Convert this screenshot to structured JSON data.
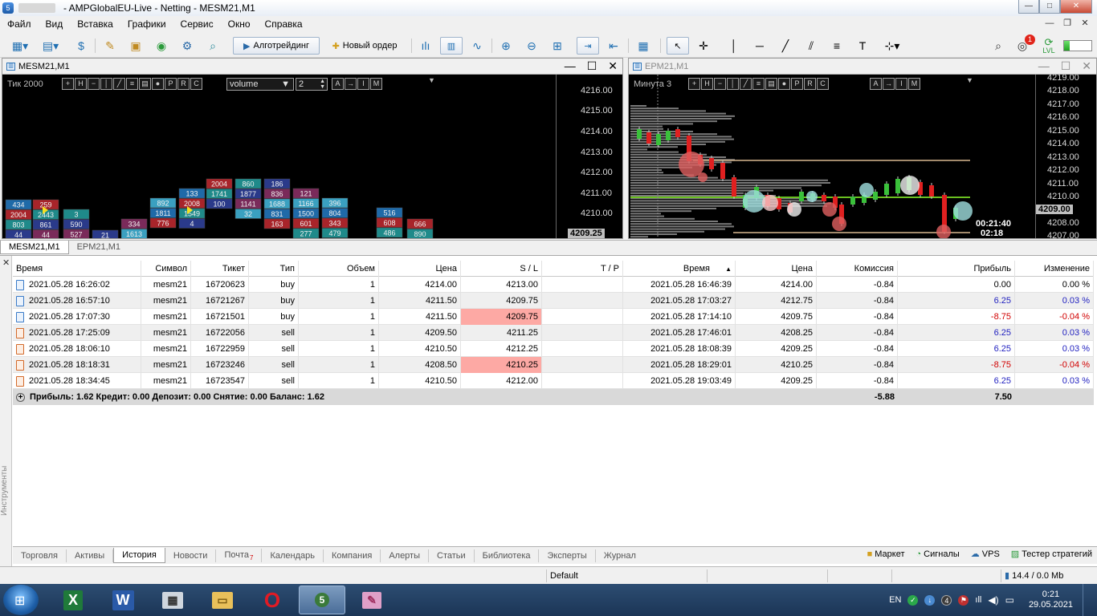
{
  "window": {
    "title": "- AMPGlobalEU-Live - Netting - MESM21,M1",
    "minimize": "—",
    "maximize": "□",
    "close": "✕"
  },
  "menu": {
    "items": [
      "Файл",
      "Вид",
      "Вставка",
      "Графики",
      "Сервис",
      "Окно",
      "Справка"
    ],
    "mdi_min": "—",
    "mdi_restore": "❐",
    "mdi_close": "✕"
  },
  "toolbar": {
    "algo_label": "Алготрейдинг",
    "new_order_label": "Новый ордер",
    "notifications_count": "1",
    "level_label": "LVL",
    "level_fraction": 0.22
  },
  "chart_left": {
    "title": "MESM21,M1",
    "indicator_label": "Тик  2000",
    "select_value": "volume",
    "select_num": "2",
    "prices": [
      "4216.00",
      "4215.00",
      "4214.00",
      "4213.00",
      "4212.00",
      "4211.00",
      "4210.00"
    ],
    "current_price": "4209.25",
    "ctrl_min": "—",
    "ctrl_max": "☐",
    "ctrl_close": "✕",
    "clusters": [
      {
        "values": [
          "434",
          "2004",
          "803",
          "44"
        ]
      },
      {
        "values": [
          "259",
          "2443",
          "861",
          "44"
        ]
      },
      {
        "values": [
          "3",
          "590",
          "527"
        ]
      },
      {
        "values": [
          "21"
        ]
      },
      {
        "values": [
          "334",
          "1613"
        ]
      },
      {
        "values": [
          "892",
          "1811",
          "776"
        ]
      },
      {
        "values": [
          "133",
          "2008",
          "1549",
          "4"
        ]
      },
      {
        "values": [
          "2004",
          "1741",
          "100"
        ]
      },
      {
        "values": [
          "860",
          "1877",
          "1141",
          "32"
        ]
      },
      {
        "values": [
          "186",
          "836",
          "1688",
          "831",
          "163"
        ]
      },
      {
        "values": [
          "121",
          "1166",
          "1500",
          "601",
          "277"
        ]
      },
      {
        "values": [
          "396",
          "804",
          "343",
          "479"
        ]
      },
      {
        "values": [
          "516",
          "608",
          "486"
        ]
      },
      {
        "values": [
          "666",
          "890"
        ]
      }
    ]
  },
  "chart_right": {
    "title": "EPM21,M1",
    "indicator_label": "Минута  3",
    "prices": [
      "4219.00",
      "4218.00",
      "4217.00",
      "4216.00",
      "4215.00",
      "4214.00",
      "4213.00",
      "4212.00",
      "4211.00",
      "4210.00",
      "4209.00",
      "4208.00",
      "4207.00"
    ],
    "current_price": "4209.00",
    "timer": "00:21:40",
    "timer2": "02:18",
    "ctrl_min": "—",
    "ctrl_max": "☐",
    "ctrl_close": "✕"
  },
  "chart_tabs": [
    "MESM21,M1",
    "EPM21,M1"
  ],
  "history": {
    "columns": [
      "Время",
      "Символ",
      "Тикет",
      "Тип",
      "Объем",
      "Цена",
      "S / L",
      "T / P",
      "Время",
      "Цена",
      "Комиссия",
      "Прибыль",
      "Изменение"
    ],
    "rows": [
      {
        "time_open": "2021.05.28 16:26:02",
        "symbol": "mesm21",
        "ticket": "16720623",
        "type": "buy",
        "volume": "1",
        "price_open": "4214.00",
        "sl": "4213.00",
        "tp": "",
        "time_close": "2021.05.28 16:46:39",
        "price_close": "4214.00",
        "commission": "-0.84",
        "profit": "0.00",
        "change": "0.00 %",
        "sl_hl": false,
        "sign": "zero"
      },
      {
        "time_open": "2021.05.28 16:57:10",
        "symbol": "mesm21",
        "ticket": "16721267",
        "type": "buy",
        "volume": "1",
        "price_open": "4211.50",
        "sl": "4209.75",
        "tp": "",
        "time_close": "2021.05.28 17:03:27",
        "price_close": "4212.75",
        "commission": "-0.84",
        "profit": "6.25",
        "change": "0.03 %",
        "sl_hl": false,
        "sign": "pos"
      },
      {
        "time_open": "2021.05.28 17:07:30",
        "symbol": "mesm21",
        "ticket": "16721501",
        "type": "buy",
        "volume": "1",
        "price_open": "4211.50",
        "sl": "4209.75",
        "tp": "",
        "time_close": "2021.05.28 17:14:10",
        "price_close": "4209.75",
        "commission": "-0.84",
        "profit": "-8.75",
        "change": "-0.04 %",
        "sl_hl": true,
        "sign": "neg"
      },
      {
        "time_open": "2021.05.28 17:25:09",
        "symbol": "mesm21",
        "ticket": "16722056",
        "type": "sell",
        "volume": "1",
        "price_open": "4209.50",
        "sl": "4211.25",
        "tp": "",
        "time_close": "2021.05.28 17:46:01",
        "price_close": "4208.25",
        "commission": "-0.84",
        "profit": "6.25",
        "change": "0.03 %",
        "sl_hl": false,
        "sign": "pos"
      },
      {
        "time_open": "2021.05.28 18:06:10",
        "symbol": "mesm21",
        "ticket": "16722959",
        "type": "sell",
        "volume": "1",
        "price_open": "4210.50",
        "sl": "4212.25",
        "tp": "",
        "time_close": "2021.05.28 18:08:39",
        "price_close": "4209.25",
        "commission": "-0.84",
        "profit": "6.25",
        "change": "0.03 %",
        "sl_hl": false,
        "sign": "pos"
      },
      {
        "time_open": "2021.05.28 18:18:31",
        "symbol": "mesm21",
        "ticket": "16723246",
        "type": "sell",
        "volume": "1",
        "price_open": "4208.50",
        "sl": "4210.25",
        "tp": "",
        "time_close": "2021.05.28 18:29:01",
        "price_close": "4210.25",
        "commission": "-0.84",
        "profit": "-8.75",
        "change": "-0.04 %",
        "sl_hl": true,
        "sign": "neg"
      },
      {
        "time_open": "2021.05.28 18:34:45",
        "symbol": "mesm21",
        "ticket": "16723547",
        "type": "sell",
        "volume": "1",
        "price_open": "4210.50",
        "sl": "4212.00",
        "tp": "",
        "time_close": "2021.05.28 19:03:49",
        "price_close": "4209.25",
        "commission": "-0.84",
        "profit": "6.25",
        "change": "0.03 %",
        "sl_hl": false,
        "sign": "pos"
      }
    ],
    "summary_text": "Прибыль: 1.62  Кредит: 0.00  Депозит: 0.00  Снятие: 0.00  Баланс: 1.62",
    "summary_commission": "-5.88",
    "summary_profit": "7.50"
  },
  "side_label": "Инструменты",
  "bottom_tabs": [
    "Торговля",
    "Активы",
    "История",
    "Новости",
    "Почта",
    "Календарь",
    "Компания",
    "Алерты",
    "Статьи",
    "Библиотека",
    "Эксперты",
    "Журнал"
  ],
  "mail_count": "7",
  "bottom_right": [
    "Маркет",
    "Сигналы",
    "VPS",
    "Тестер стратегий"
  ],
  "status": {
    "profile": "Default",
    "traffic": "14.4 / 0.0 Mb"
  },
  "tray": {
    "lang": "EN",
    "time": "0:21",
    "date": "29.05.2021"
  },
  "colors": {
    "sl_highlight": "#fda9a4",
    "negative": "#d10000",
    "positive": "#1f1fbf"
  }
}
